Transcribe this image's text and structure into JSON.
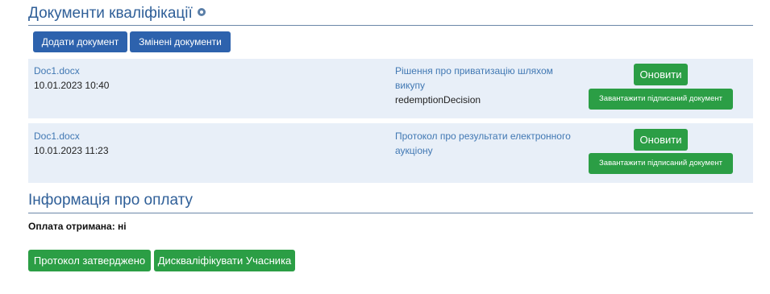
{
  "qualification": {
    "title": "Документи кваліфікації",
    "add_document_label": "Додати документ",
    "changed_documents_label": "Змінені документи",
    "documents": [
      {
        "file_name": "Doc1.docx",
        "date": "10.01.2023 10:40",
        "type_label": "Рішення про приватизацію шляхом викупу",
        "type_code": "redemptionDecision",
        "update_label": "Оновити",
        "download_signed_label": "Завантажити підписаний документ"
      },
      {
        "file_name": "Doc1.docx",
        "date": "10.01.2023 11:23",
        "type_label": "Протокол про результати електронного аукціону",
        "type_code": "",
        "update_label": "Оновити",
        "download_signed_label": "Завантажити підписаний документ"
      }
    ]
  },
  "payment": {
    "title": "Інформація про оплату",
    "received_text": "Оплата отримана: ні",
    "protocol_approved_label": "Протокол затверджено",
    "disqualify_label": "Дискваліфікувати Учасника"
  },
  "colors": {
    "heading": "#2f5f98",
    "primary_button": "#2d62ad",
    "success_button": "#2b9e45",
    "row_background": "#e8eff8",
    "link": "#4178b3"
  },
  "icons": {
    "title_icon": "info-circle-icon"
  }
}
